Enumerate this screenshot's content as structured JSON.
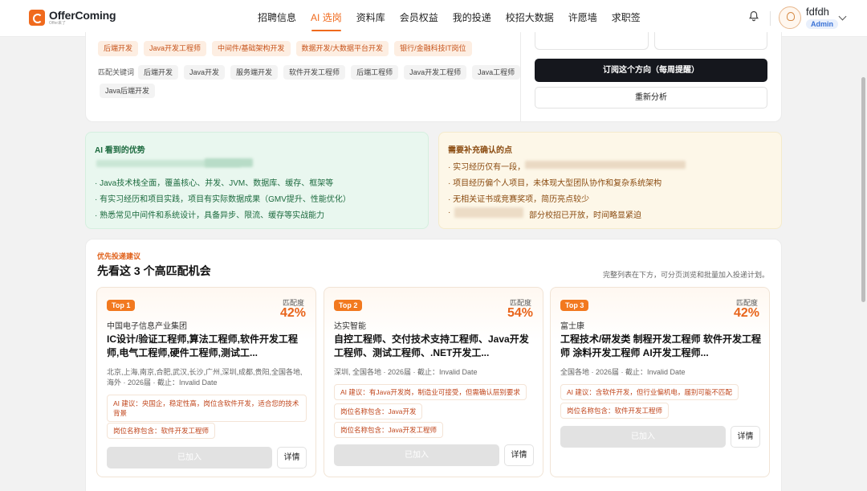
{
  "brand": {
    "name": "OfferComing",
    "sub": "Offer来了"
  },
  "nav": [
    "招聘信息",
    "AI 选岗",
    "资料库",
    "会员权益",
    "我的投递",
    "校招大数据",
    "许愿墙",
    "求职签"
  ],
  "user": {
    "name": "fdfdh",
    "role": "Admin"
  },
  "top": {
    "direction_tags": [
      "后端开发",
      "Java开发工程师",
      "中间件/基础架构开发",
      "数据开发/大数据平台开发",
      "银行/金融科技IT岗位"
    ],
    "keyword_label": "匹配关键词",
    "keywords": [
      "后端开发",
      "Java开发",
      "服务端开发",
      "软件开发工程师",
      "后端工程师",
      "Java开发工程师",
      "Java工程师",
      "Java后端开发"
    ],
    "subscribe_label": "订阅这个方向（每周提醒）",
    "reanalyze_label": "重新分析"
  },
  "strengths": {
    "title": "AI 看到的优势",
    "items": [
      "· Java技术栈全面，覆盖核心、并发、JVM、数据库、缓存、框架等",
      "· 有实习经历和项目实践，项目有实际数据成果（GMV提升、性能优化）",
      "· 熟悉常见中间件和系统设计，具备异步、限流、缓存等实战能力"
    ]
  },
  "gaps": {
    "title": "需要补充确认的点",
    "items": [
      "· 实习经历仅有一段，",
      "· 项目经历偏个人项目，未体现大型团队协作和复杂系统架构",
      "· 无相关证书或竞赛奖项，简历亮点较少",
      "部分校招已开放，时间略显紧迫"
    ],
    "bullet": "·"
  },
  "recommend": {
    "kicker": "优先投递建议",
    "title": "先看这 3 个高匹配机会",
    "hint": "完整列表在下方，可分页浏览和批量加入投递计划。",
    "match_label": "匹配度",
    "added_label": "已加入",
    "detail_label": "详情",
    "jobs": [
      {
        "rank": "Top 1",
        "match": "42%",
        "company": "中国电子信息产业集团",
        "title": "IC设计/验证工程师,算法工程师,软件开发工程师,电气工程师,硬件工程师,测试工...",
        "meta": "北京,上海,南京,合肥,武汉,长沙,广州,深圳,成都,贵阳,全国各地,海外 · 2026届 · 截止：Invalid Date",
        "ai_tip": "AI 建议：央国企，稳定性高，岗位含软件开发，适合您的技术背景",
        "pos_tips": [
          "岗位名称包含：软件开发工程师"
        ]
      },
      {
        "rank": "Top 2",
        "match": "54%",
        "company": "达实智能",
        "title": "自控工程师、交付技术支持工程师、Java开发工程师、测试工程师、.NET开发工...",
        "meta": "深圳, 全国各地 · 2026届 · 截止：Invalid Date",
        "ai_tip": "AI 建议：有Java开发岗，制造业可接受，但需确认层别要求",
        "pos_tips": [
          "岗位名称包含：Java开发",
          "岗位名称包含：Java开发工程师"
        ]
      },
      {
        "rank": "Top 3",
        "match": "42%",
        "company": "富士康",
        "title": "工程技术/研发类 制程开发工程师 软件开发工程师 涂料开发工程师 AI开发工程师...",
        "meta": "全国各地 · 2026届 · 截止：Invalid Date",
        "ai_tip": "AI 建议：含软件开发，但行业偏机电，届别可能不匹配",
        "pos_tips": [
          "岗位名称包含：软件开发工程师"
        ]
      }
    ]
  },
  "colors": {
    "accent": "#f06a1d",
    "dark": "#15171d",
    "green_bg": "#e9f7ef",
    "yellow_bg": "#fdf7e8"
  },
  "icons": {
    "bell": "bell-icon",
    "chevron": "chevron-down-icon",
    "avatar": "avatar-icon"
  }
}
